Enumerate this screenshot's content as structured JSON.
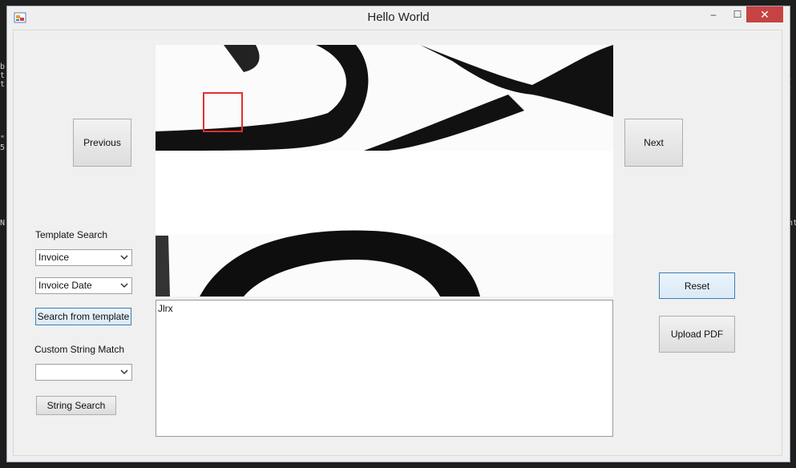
{
  "window": {
    "title": "Hello World",
    "close_glyph": "✕",
    "max_glyph": "☐",
    "min_glyph": "‒"
  },
  "nav": {
    "previous": "Previous",
    "next": "Next"
  },
  "template_search": {
    "label": "Template Search",
    "template_value": "Invoice",
    "field_value": "Invoice Date",
    "search_button": "Search from template"
  },
  "custom_match": {
    "label": "Custom String Match",
    "value": "",
    "search_button": "String Search"
  },
  "actions": {
    "reset": "Reset",
    "upload": "Upload PDF"
  },
  "output": {
    "text": "Jlrx"
  },
  "colors": {
    "selection_box": "#e03030",
    "close_button": "#c74343"
  }
}
